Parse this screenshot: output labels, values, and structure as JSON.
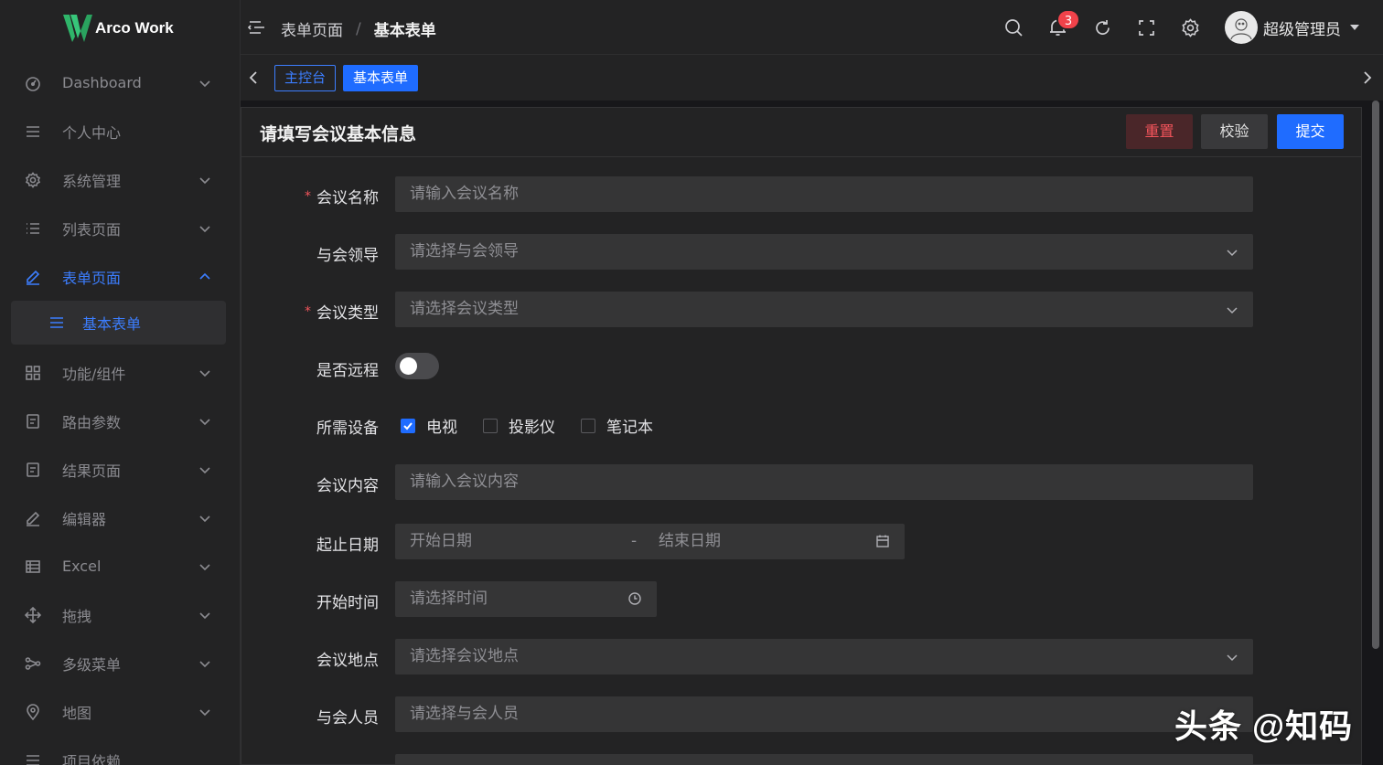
{
  "app": {
    "logo_text": "Arco Work"
  },
  "sidebar": {
    "items": [
      {
        "label": "Dashboard",
        "icon": "dashboard-icon"
      },
      {
        "label": "个人中心",
        "icon": "list-icon"
      },
      {
        "label": "系统管理",
        "icon": "gear-icon"
      },
      {
        "label": "列表页面",
        "icon": "list-icon"
      },
      {
        "label": "表单页面",
        "icon": "edit-icon"
      },
      {
        "label": "基本表单",
        "icon": "list-icon"
      },
      {
        "label": "功能/组件",
        "icon": "grid-icon"
      },
      {
        "label": "路由参数",
        "icon": "file-icon"
      },
      {
        "label": "结果页面",
        "icon": "file-icon"
      },
      {
        "label": "编辑器",
        "icon": "edit-icon"
      },
      {
        "label": "Excel",
        "icon": "table-icon"
      },
      {
        "label": "拖拽",
        "icon": "move-icon"
      },
      {
        "label": "多级菜单",
        "icon": "share-icon"
      },
      {
        "label": "地图",
        "icon": "location-icon"
      },
      {
        "label": "项目依赖",
        "icon": "list-icon"
      }
    ]
  },
  "header": {
    "breadcrumb": [
      "表单页面",
      "基本表单"
    ],
    "breadcrumb_sep": "/",
    "notification_count": "3",
    "username": "超级管理员"
  },
  "tabs": [
    {
      "label": "主控台"
    },
    {
      "label": "基本表单"
    }
  ],
  "card": {
    "title": "请填写会议基本信息",
    "buttons": {
      "reset": "重置",
      "validate": "校验",
      "submit": "提交"
    }
  },
  "form": {
    "meeting_name": {
      "label": "会议名称",
      "placeholder": "请输入会议名称",
      "required": "*"
    },
    "leader": {
      "label": "与会领导",
      "placeholder": "请选择与会领导"
    },
    "meeting_type": {
      "label": "会议类型",
      "placeholder": "请选择会议类型",
      "required": "*"
    },
    "remote": {
      "label": "是否远程",
      "on": false
    },
    "devices": {
      "label": "所需设备",
      "options": [
        {
          "label": "电视",
          "checked": true
        },
        {
          "label": "投影仪",
          "checked": false
        },
        {
          "label": "笔记本",
          "checked": false
        }
      ]
    },
    "content": {
      "label": "会议内容",
      "placeholder": "请输入会议内容"
    },
    "date_range": {
      "label": "起止日期",
      "start_placeholder": "开始日期",
      "end_placeholder": "结束日期",
      "separator": "-"
    },
    "start_time": {
      "label": "开始时间",
      "placeholder": "请选择时间"
    },
    "location": {
      "label": "会议地点",
      "placeholder": "请选择会议地点"
    },
    "attendees": {
      "label": "与会人员",
      "placeholder": "请选择与会人员"
    }
  },
  "watermark": "头条 @知码",
  "colors": {
    "accent": "#1f6cff",
    "danger": "#f2545b",
    "bg": "#17171a",
    "panel": "#232324",
    "input": "#353536"
  }
}
